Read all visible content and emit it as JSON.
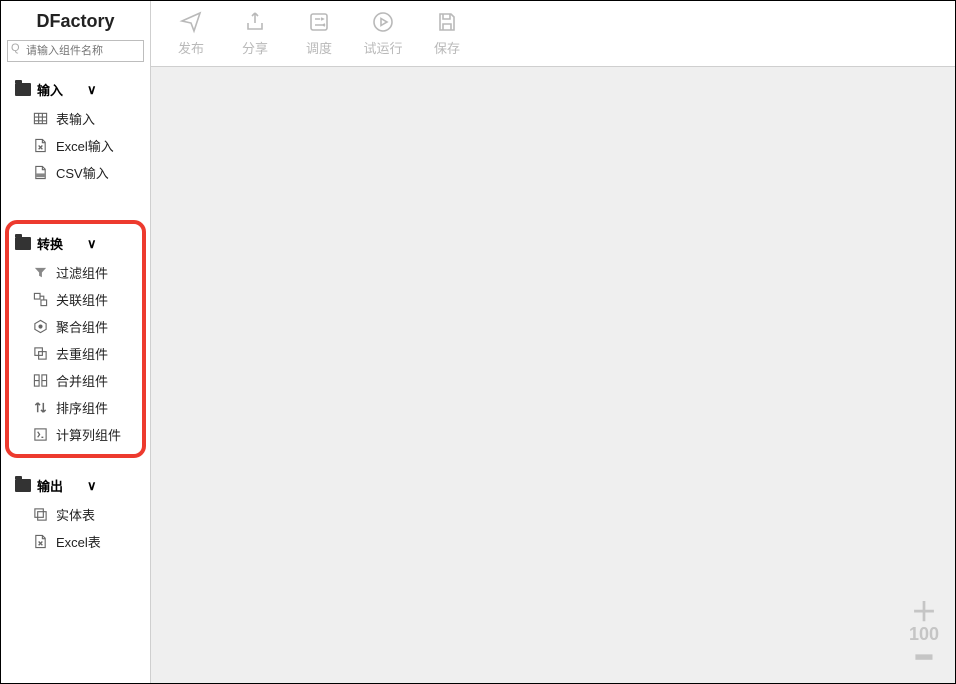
{
  "brand": "DFactory",
  "search": {
    "placeholder": "请输入组件名称"
  },
  "toolbar": {
    "publish": "发布",
    "share": "分享",
    "schedule": "调度",
    "trial_run": "试运行",
    "save": "保存"
  },
  "sidebar": {
    "groups": [
      {
        "label": "输入",
        "expanded": true,
        "items": [
          {
            "icon": "grid-icon",
            "label": "表输入"
          },
          {
            "icon": "excel-icon",
            "label": "Excel输入"
          },
          {
            "icon": "csv-icon",
            "label": "CSV输入"
          }
        ]
      },
      {
        "label": "转换",
        "expanded": true,
        "highlighted": true,
        "items": [
          {
            "icon": "funnel-icon",
            "label": "过滤组件"
          },
          {
            "icon": "relate-icon",
            "label": "关联组件"
          },
          {
            "icon": "aggregate-icon",
            "label": "聚合组件"
          },
          {
            "icon": "dedupe-icon",
            "label": "去重组件"
          },
          {
            "icon": "merge-icon",
            "label": "合并组件"
          },
          {
            "icon": "sort-icon",
            "label": "排序组件"
          },
          {
            "icon": "calc-icon",
            "label": "计算列组件"
          }
        ]
      },
      {
        "label": "输出",
        "expanded": true,
        "items": [
          {
            "icon": "solid-table-icon",
            "label": "实体表"
          },
          {
            "icon": "excel-out-icon",
            "label": "Excel表"
          }
        ]
      }
    ]
  },
  "canvas": {
    "zoom_percent": "100"
  }
}
